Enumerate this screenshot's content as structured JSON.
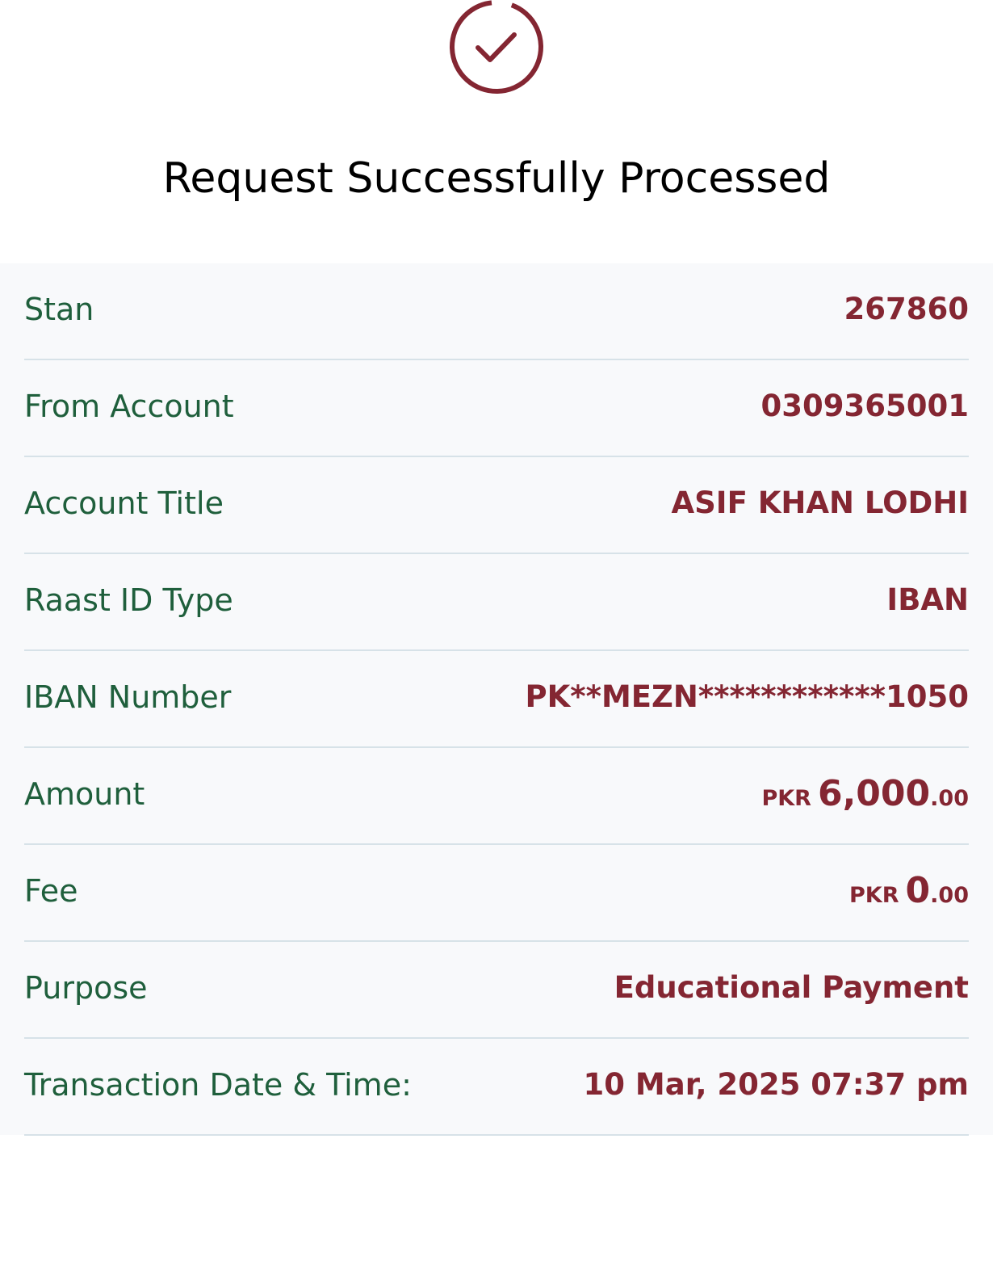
{
  "header": {
    "title": "Request Successfully Processed",
    "icon": "check-circle-icon",
    "icon_color": "#842632"
  },
  "colors": {
    "label": "#1f5f3c",
    "value": "#842632",
    "panel_bg": "#f8f9fb",
    "divider": "#d7e2e8"
  },
  "details": {
    "stan": {
      "label": "Stan",
      "value": "267860"
    },
    "from_account": {
      "label": "From Account",
      "value": "0309365001"
    },
    "account_title": {
      "label": "Account Title",
      "value": "ASIF KHAN LODHI"
    },
    "raast_id_type": {
      "label": "Raast ID Type",
      "value": "IBAN"
    },
    "iban_number": {
      "label": "IBAN Number",
      "value": "PK**MEZN************1050"
    },
    "amount": {
      "label": "Amount",
      "currency": "PKR",
      "whole": "6,000",
      "decimal": ".00"
    },
    "fee": {
      "label": "Fee",
      "currency": "PKR",
      "whole": "0",
      "decimal": ".00"
    },
    "purpose": {
      "label": "Purpose",
      "value": "Educational Payment"
    },
    "transaction_datetime": {
      "label": "Transaction Date & Time:",
      "value": "10 Mar, 2025 07:37 pm"
    }
  }
}
